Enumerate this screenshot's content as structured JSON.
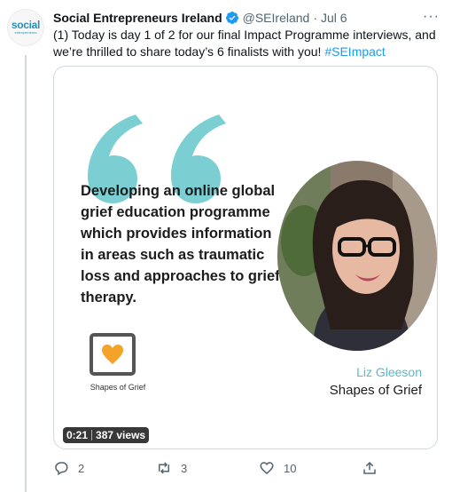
{
  "account": {
    "avatar_text_big": "social",
    "avatar_text_small": "entrepreneurs",
    "name": "Social Entrepreneurs Ireland",
    "handle": "@SEIreland",
    "separator": "·",
    "date": "Jul 6"
  },
  "more_label": "···",
  "tweet": {
    "text": "(1) Today is day 1 of 2 for our final Impact Programme interviews, and we’re thrilled to share today’s 6 finalists with you! ",
    "hashtag": "#SEImpact"
  },
  "media": {
    "quote": "Developing an online global grief education programme which provides information in areas such as traumatic loss and approaches to grief therapy.",
    "logo_label": "Shapes of Grief",
    "person_name": "Liz Gleeson",
    "person_org": "Shapes of Grief",
    "duration": "0:21",
    "views": "387 views",
    "colors": {
      "quote_mark": "#7bcfd3",
      "name_accent": "#5bb8c9",
      "heart": "#f4a32a"
    }
  },
  "actions": {
    "reply_count": "2",
    "retweet_count": "3",
    "like_count": "10"
  },
  "icons": [
    "verified-badge-icon",
    "more-icon",
    "reply-icon",
    "retweet-icon",
    "like-icon",
    "share-icon"
  ]
}
